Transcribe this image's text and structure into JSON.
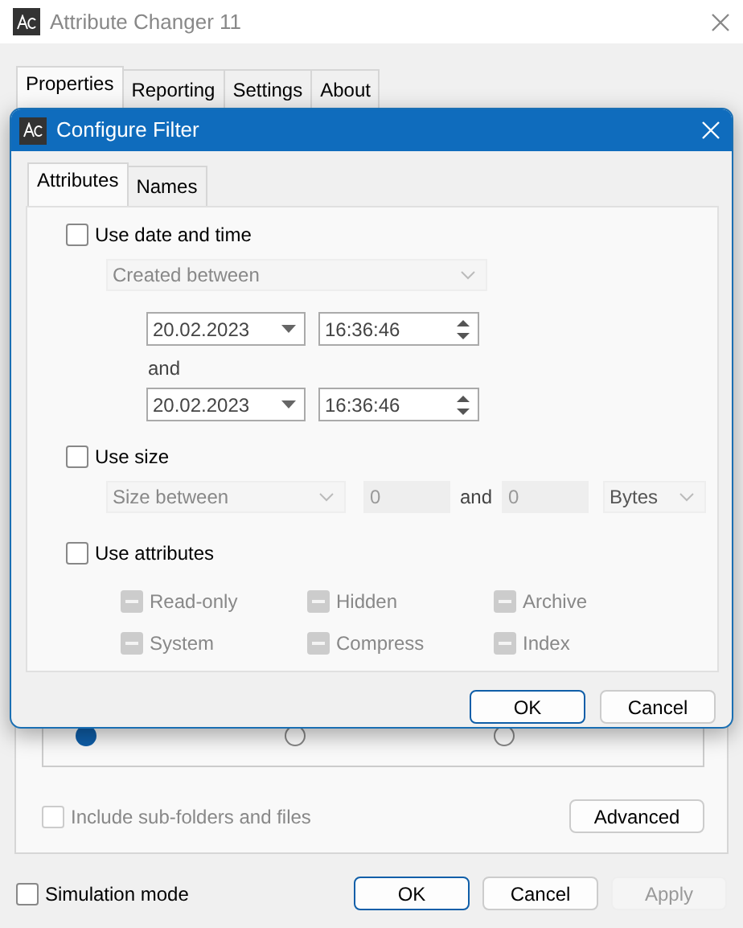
{
  "window": {
    "title": "Attribute Changer 11"
  },
  "tabs": [
    {
      "label": "Properties",
      "selected": true
    },
    {
      "label": "Reporting",
      "selected": false
    },
    {
      "label": "Settings",
      "selected": false
    },
    {
      "label": "About",
      "selected": false
    }
  ],
  "scope_radios": [
    {
      "selected": true
    },
    {
      "selected": false
    },
    {
      "selected": false
    }
  ],
  "include_subfolders": {
    "label": "Include sub-folders and files",
    "checked": false,
    "disabled": true
  },
  "advanced_button": "Advanced",
  "simulation_mode": {
    "label": "Simulation mode",
    "checked": false
  },
  "buttons": [
    {
      "label": "OK",
      "default": true,
      "disabled": false
    },
    {
      "label": "Cancel",
      "default": false,
      "disabled": false
    },
    {
      "label": "Apply",
      "default": false,
      "disabled": true
    }
  ],
  "dialog": {
    "title": "Configure Filter",
    "tabs": [
      {
        "label": "Attributes",
        "selected": true
      },
      {
        "label": "Names",
        "selected": false
      }
    ],
    "date": {
      "label": "Use date and time",
      "checked": false,
      "mode": "Created between",
      "from_date": "20.02.2023",
      "from_time": "16:36:46",
      "and_label": "and",
      "to_date": "20.02.2023",
      "to_time": "16:36:46"
    },
    "size": {
      "label": "Use size",
      "checked": false,
      "mode": "Size between",
      "min": "0",
      "and_label": "and",
      "max": "0",
      "unit": "Bytes"
    },
    "attributes": {
      "label": "Use attributes",
      "checked": false,
      "items": [
        {
          "label": "Read-only",
          "indeterminate": true
        },
        {
          "label": "Hidden",
          "indeterminate": true
        },
        {
          "label": "Archive",
          "indeterminate": true
        },
        {
          "label": "System",
          "indeterminate": true
        },
        {
          "label": "Compress",
          "indeterminate": true
        },
        {
          "label": "Index",
          "indeterminate": true
        }
      ]
    },
    "buttons": [
      {
        "label": "OK",
        "default": true
      },
      {
        "label": "Cancel",
        "default": false
      }
    ]
  }
}
